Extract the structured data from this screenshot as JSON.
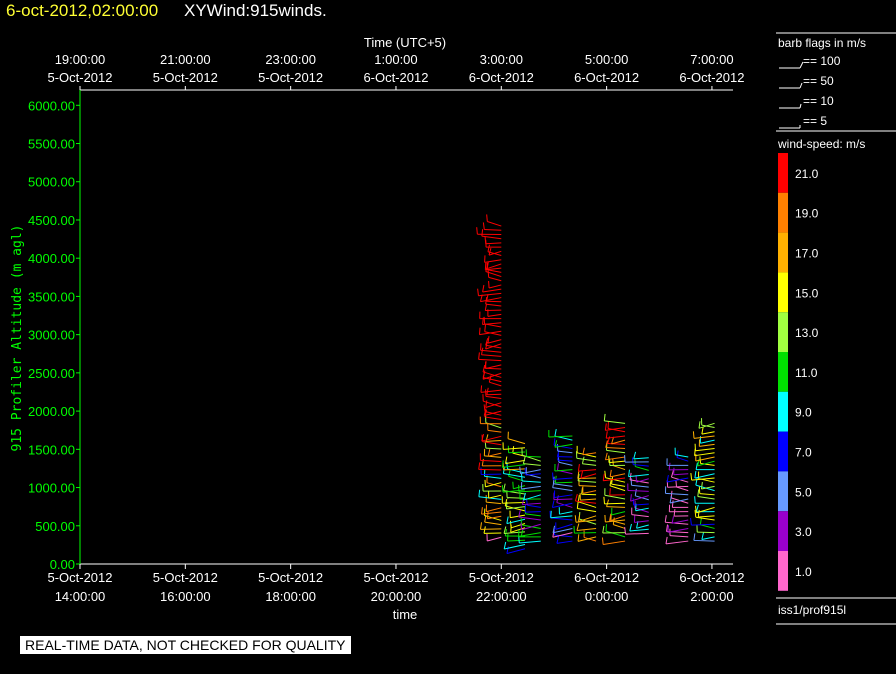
{
  "header": {
    "datetime": "6-oct-2012,02:00:00",
    "product": "XYWind:915winds."
  },
  "chart_data": {
    "type": "scatter",
    "mark": "wind-barb",
    "x_axis_bottom": {
      "label": "time",
      "ticks": [
        {
          "line1": "5-Oct-2012",
          "line2": "14:00:00",
          "hour": 0
        },
        {
          "line1": "5-Oct-2012",
          "line2": "16:00:00",
          "hour": 2
        },
        {
          "line1": "5-Oct-2012",
          "line2": "18:00:00",
          "hour": 4
        },
        {
          "line1": "5-Oct-2012",
          "line2": "20:00:00",
          "hour": 6
        },
        {
          "line1": "5-Oct-2012",
          "line2": "22:00:00",
          "hour": 8
        },
        {
          "line1": "6-Oct-2012",
          "line2": "0:00:00",
          "hour": 10
        },
        {
          "line1": "6-Oct-2012",
          "line2": "2:00:00",
          "hour": 12
        }
      ]
    },
    "x_axis_top": {
      "label": "Time (UTC+5)",
      "ticks": [
        {
          "line1": "19:00:00",
          "line2": "5-Oct-2012",
          "hour": 0
        },
        {
          "line1": "21:00:00",
          "line2": "5-Oct-2012",
          "hour": 2
        },
        {
          "line1": "23:00:00",
          "line2": "5-Oct-2012",
          "hour": 4
        },
        {
          "line1": "1:00:00",
          "line2": "6-Oct-2012",
          "hour": 6
        },
        {
          "line1": "3:00:00",
          "line2": "6-Oct-2012",
          "hour": 8
        },
        {
          "line1": "5:00:00",
          "line2": "6-Oct-2012",
          "hour": 10
        },
        {
          "line1": "7:00:00",
          "line2": "6-Oct-2012",
          "hour": 12
        }
      ]
    },
    "y_axis": {
      "label": "915 Profiler Altitude (m agl)",
      "min": 0,
      "max": 6200,
      "ticks": [
        "0.00",
        "500.00",
        "1000.00",
        "1500.00",
        "2000.00",
        "2500.00",
        "3000.00",
        "3500.00",
        "4000.00",
        "4500.00",
        "5000.00",
        "5500.00",
        "6000.00"
      ]
    },
    "x_range_hours": [
      0,
      12.4
    ],
    "barb_legend": {
      "title": "barb flags in m/s",
      "items": [
        "== 100",
        "== 50",
        "== 10",
        "== 5"
      ]
    },
    "speed_scale": {
      "title": "wind-speed: m/s",
      "bins": [
        {
          "label": "21.0",
          "color": "#ff0000"
        },
        {
          "label": "19.0",
          "color": "#ff8000"
        },
        {
          "label": "17.0",
          "color": "#ffb000"
        },
        {
          "label": "15.0",
          "color": "#ffff00"
        },
        {
          "label": "13.0",
          "color": "#a0ff40"
        },
        {
          "label": "11.0",
          "color": "#00e000"
        },
        {
          "label": "9.0",
          "color": "#00ffff"
        },
        {
          "label": "7.0",
          "color": "#0000ff"
        },
        {
          "label": "5.0",
          "color": "#6699ff"
        },
        {
          "label": "3.0",
          "color": "#9900cc"
        },
        {
          "label": "1.0",
          "color": "#ff66cc"
        }
      ]
    },
    "source": "iss1/prof915l",
    "profiles": [
      {
        "hour": 8.0,
        "min_alt": 350,
        "max_alt": 4450,
        "peak_speed": 21
      },
      {
        "hour": 8.45,
        "min_alt": 200,
        "max_alt": 1600,
        "peak_speed": 13
      },
      {
        "hour": 8.75,
        "min_alt": 300,
        "max_alt": 1400,
        "peak_speed": 9
      },
      {
        "hour": 9.35,
        "min_alt": 300,
        "max_alt": 1700,
        "peak_speed": 7
      },
      {
        "hour": 9.8,
        "min_alt": 300,
        "max_alt": 1500,
        "peak_speed": 17
      },
      {
        "hour": 10.35,
        "min_alt": 300,
        "max_alt": 1850,
        "peak_speed": 17
      },
      {
        "hour": 10.8,
        "min_alt": 400,
        "max_alt": 1400,
        "peak_speed": 7
      },
      {
        "hour": 11.55,
        "min_alt": 300,
        "max_alt": 1450,
        "peak_speed": 3
      },
      {
        "hour": 12.05,
        "min_alt": 300,
        "max_alt": 1850,
        "peak_speed": 13
      }
    ]
  },
  "footer": {
    "quality_note": "REAL-TIME DATA, NOT CHECKED FOR QUALITY"
  }
}
